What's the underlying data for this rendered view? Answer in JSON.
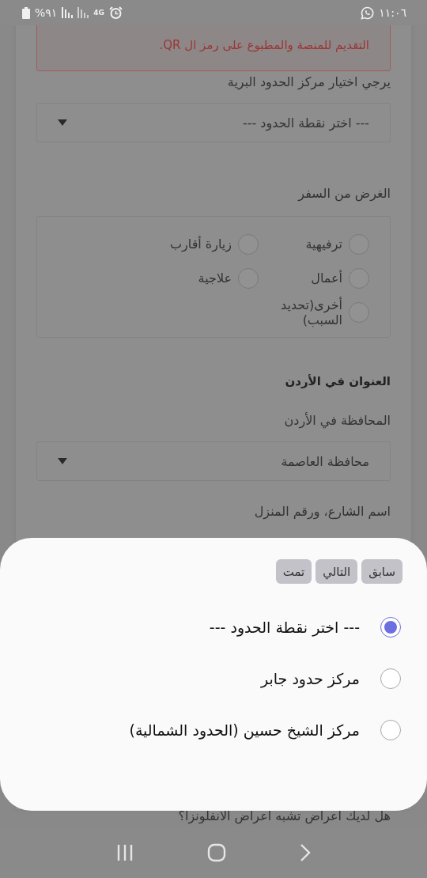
{
  "status_bar": {
    "battery": "%٩١",
    "network": "4G",
    "time": "١١:٠٦"
  },
  "form": {
    "error_text": "التقديم للمنصة والمطبوع على رمز ال QR.",
    "border_label": "يرجي اختيار مركز الحدود البرية",
    "border_select": {
      "value": "--- اختر نقطة الحدود ---"
    },
    "purpose_label": "الغرض من السفر",
    "purpose_options": [
      {
        "label": "ترفيهية",
        "selected": false
      },
      {
        "label": "زيارة أقارب",
        "selected": false
      },
      {
        "label": "أعمال",
        "selected": false
      },
      {
        "label": "علاجية",
        "selected": false
      },
      {
        "label": "أخرى(تحديد السبب)",
        "selected": false
      }
    ],
    "address_heading": "العنوان في الأردن",
    "governorate_label": "المحافظة في الأردن",
    "governorate_select": {
      "value": "محافظة العاصمة"
    },
    "street_label": "اسم الشارع، ورقم المنزل",
    "symptoms_question": "هل لديك اعراض تشبه اعراض الانفلونزا؟"
  },
  "picker": {
    "buttons": [
      "سابق",
      "التالي",
      "تمت"
    ],
    "options": [
      {
        "label": "--- اختر نقطة الحدود ---",
        "selected": true
      },
      {
        "label": "مركز حدود جابر",
        "selected": false
      },
      {
        "label": "مركز الشيخ حسين (الحدود الشمالية)",
        "selected": false
      }
    ]
  }
}
